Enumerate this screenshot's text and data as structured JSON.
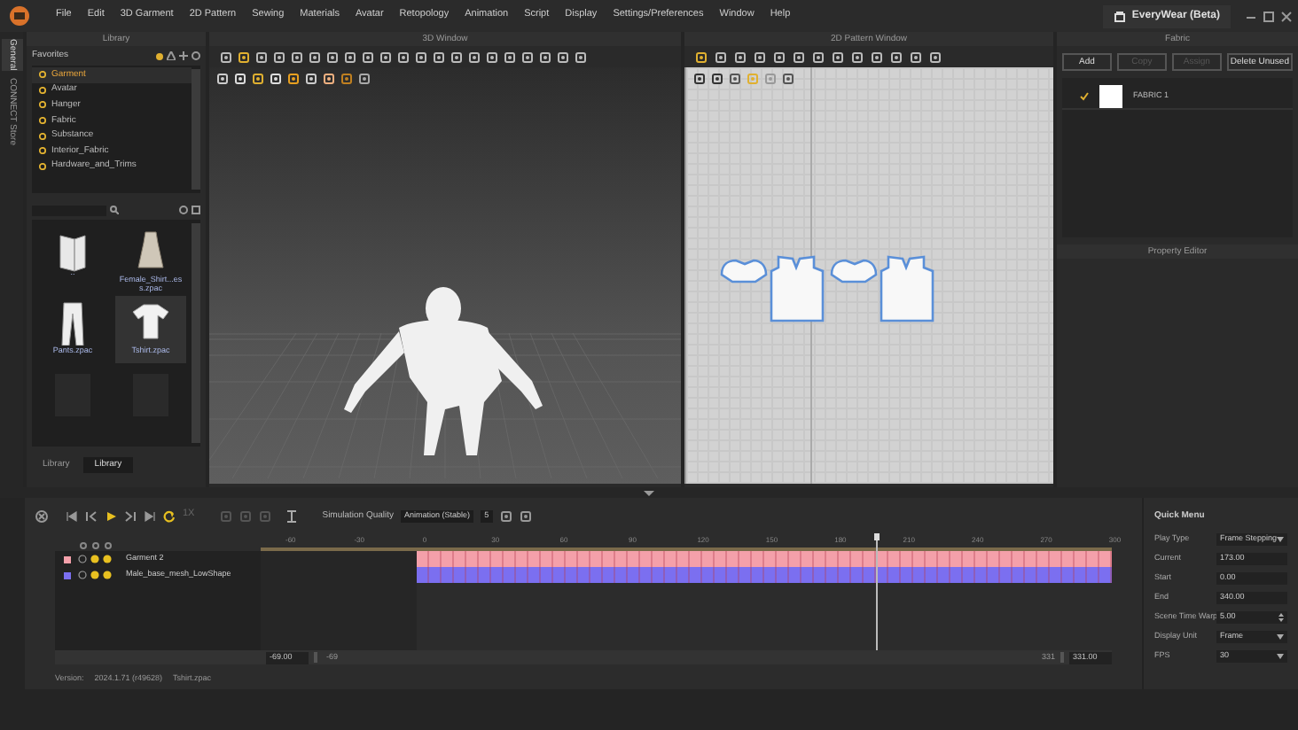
{
  "menu": [
    "File",
    "Edit",
    "3D Garment",
    "2D Pattern",
    "Sewing",
    "Materials",
    "Avatar",
    "Retopology",
    "Animation",
    "Script",
    "Display",
    "Settings/Preferences",
    "Window",
    "Help"
  ],
  "app_title": "EveryWear (Beta)",
  "side_tabs": [
    {
      "label": "General",
      "selected": true
    },
    {
      "label": "CONNECT Store",
      "selected": false
    }
  ],
  "library": {
    "title": "Library",
    "favorites_label": "Favorites",
    "favorites": [
      {
        "label": "Garment",
        "selected": true
      },
      {
        "label": "Avatar",
        "selected": false
      },
      {
        "label": "Hanger",
        "selected": false
      },
      {
        "label": "Fabric",
        "selected": false
      },
      {
        "label": "Substance",
        "selected": false
      },
      {
        "label": "Interior_Fabric",
        "selected": false
      },
      {
        "label": "Hardware_and_Trims",
        "selected": false
      }
    ],
    "files": [
      {
        "kind": "folder",
        "label": "..",
        "selected": false
      },
      {
        "kind": "dress",
        "label": "Female_Shirt...ess.zpac",
        "selected": false
      },
      {
        "kind": "pants",
        "label": "Pants.zpac",
        "selected": false
      },
      {
        "kind": "tshirt",
        "label": "Tshirt.zpac",
        "selected": true
      },
      {
        "kind": "dark",
        "selected": false
      },
      {
        "kind": "dark",
        "selected": false
      }
    ],
    "tabs": [
      {
        "label": "Library",
        "selected": false
      },
      {
        "label": "Library",
        "selected": true
      }
    ]
  },
  "window_3d": {
    "title": "3D Window"
  },
  "window_2d": {
    "title": "2D Pattern Window"
  },
  "fabric": {
    "title": "Fabric",
    "buttons": [
      {
        "label": "Add",
        "disabled": false
      },
      {
        "label": "Copy",
        "disabled": true
      },
      {
        "label": "Assign",
        "disabled": true
      },
      {
        "label": "Delete Unused",
        "disabled": false
      }
    ],
    "items": [
      {
        "name": "FABRIC 1",
        "checked": true
      }
    ]
  },
  "property_editor": {
    "title": "Property Editor"
  },
  "timeline": {
    "simulation_quality_label": "Simulation Quality",
    "simulation_quality": "Animation (Stable)",
    "steps": "5",
    "speed": "1X",
    "ticks": [
      "-60",
      "-30",
      "0",
      "30",
      "60",
      "90",
      "120",
      "150",
      "180",
      "210",
      "240",
      "270",
      "300"
    ],
    "tracks": [
      {
        "name": "Garment 2",
        "color": "#f4a0aa"
      },
      {
        "name": "Male_base_mesh_LowShape",
        "color": "#7b6ff0"
      }
    ],
    "start_field": "-69.00",
    "start_value": "-69",
    "end_value": "331",
    "end_field": "331.00"
  },
  "quick_menu": {
    "title": "Quick Menu",
    "fields": [
      {
        "label": "Play Type",
        "value": "Frame Stepping",
        "kind": "dropdown"
      },
      {
        "label": "Current",
        "value": "173.00",
        "kind": "text"
      },
      {
        "label": "Start",
        "value": "0.00",
        "kind": "text"
      },
      {
        "label": "End",
        "value": "340.00",
        "kind": "text"
      },
      {
        "label": "Scene Time Warp",
        "value": "5.00",
        "kind": "spin"
      },
      {
        "label": "Display Unit",
        "value": "Frame",
        "kind": "dropdown"
      },
      {
        "label": "FPS",
        "value": "30",
        "kind": "dropdown"
      }
    ]
  },
  "status_bar": {
    "label": "Version:",
    "version": "2024.1.71 (r49628)",
    "file": "Tshirt.zpac"
  }
}
